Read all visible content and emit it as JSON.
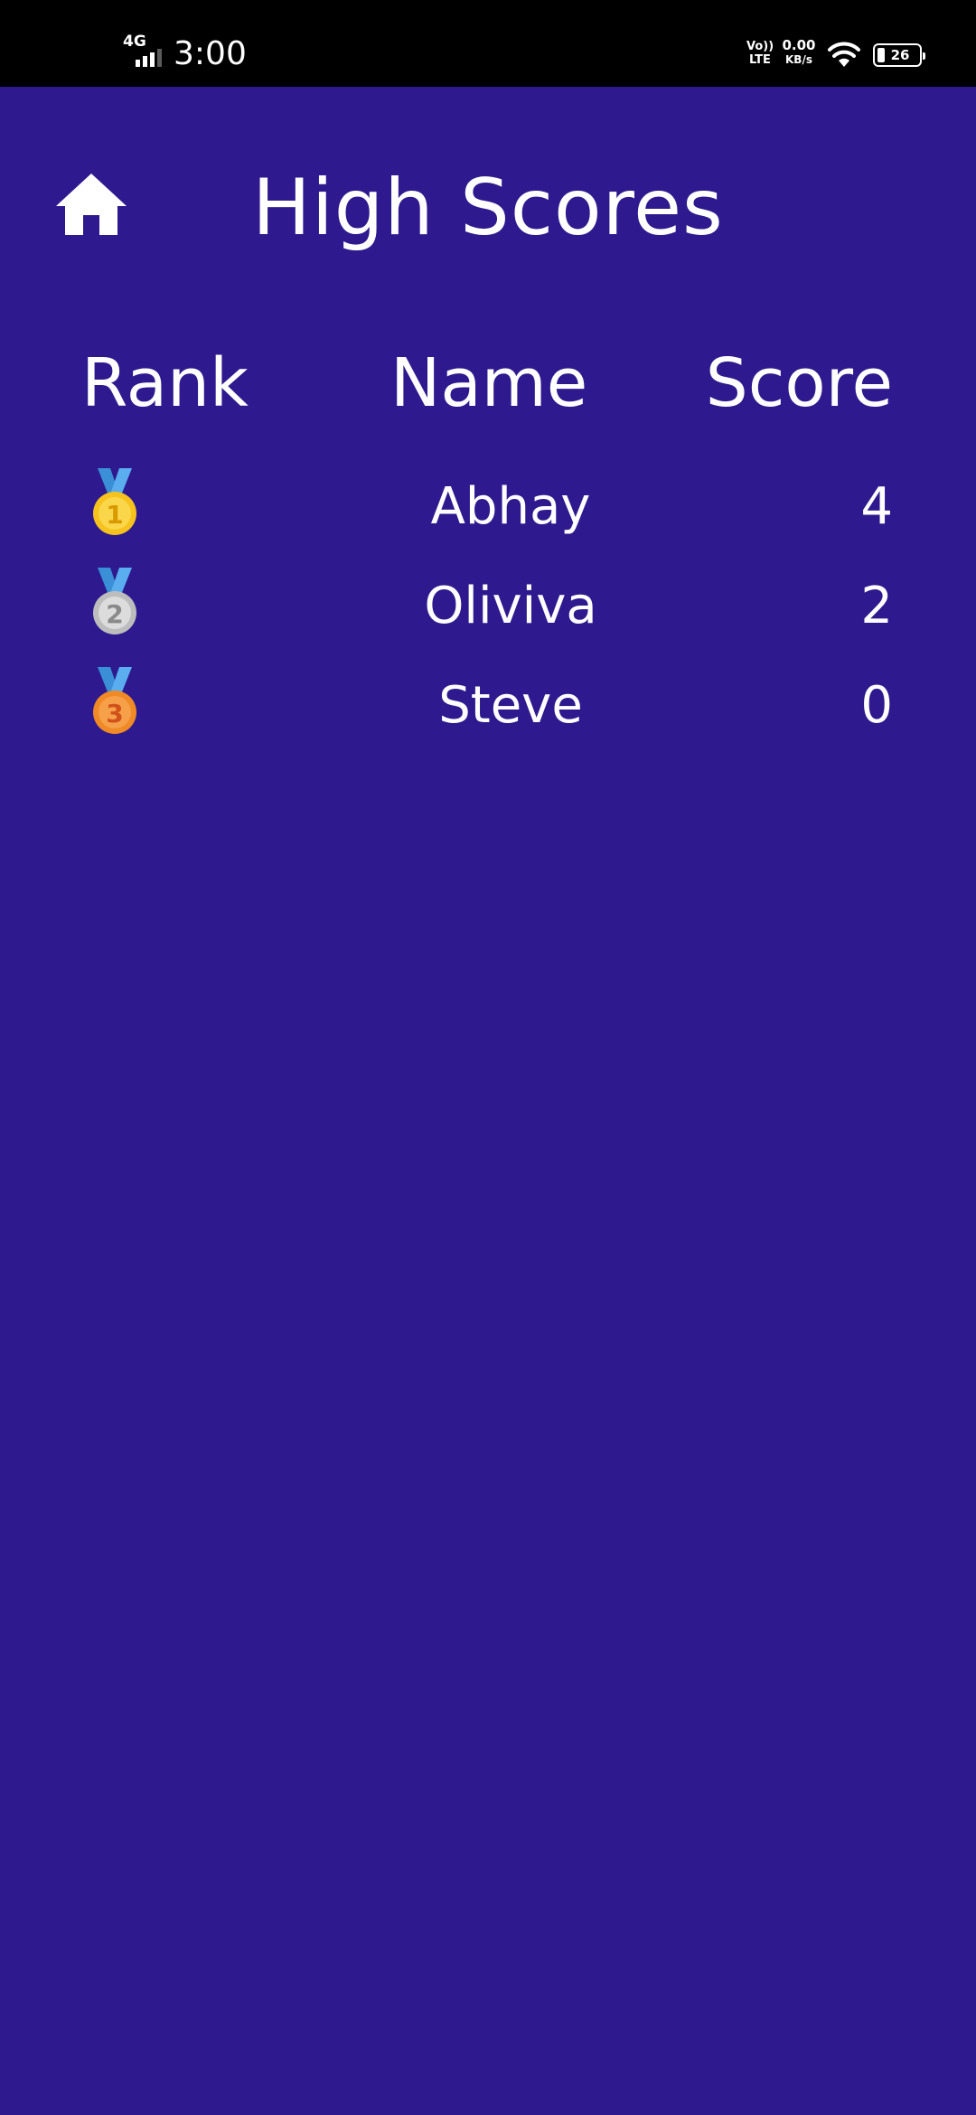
{
  "status_bar": {
    "network": "4G",
    "time": "3:00",
    "volte_top": "Vo))",
    "volte_bottom": "LTE",
    "speed_value": "0.00",
    "speed_unit": "KB/s",
    "battery": "26",
    "icons": [
      "signal-icon",
      "wifi-icon",
      "battery-icon"
    ]
  },
  "header": {
    "title": "High Scores",
    "home_icon": "home-icon"
  },
  "table": {
    "columns": [
      "Rank",
      "Name",
      "Score"
    ],
    "rows": [
      {
        "rank": 1,
        "medal": "gold-medal-icon",
        "name": "Abhay",
        "score": "4"
      },
      {
        "rank": 2,
        "medal": "silver-medal-icon",
        "name": "Oliviva",
        "score": "2"
      },
      {
        "rank": 3,
        "medal": "bronze-medal-icon",
        "name": "Steve",
        "score": "0"
      }
    ]
  },
  "colors": {
    "background": "#2e1a8e",
    "status_bar": "#000000",
    "text": "#ffffff",
    "gold": "#f6c21d",
    "silver": "#c9c9c9",
    "bronze": "#ef8a26",
    "ribbon": "#3a8fd6"
  }
}
